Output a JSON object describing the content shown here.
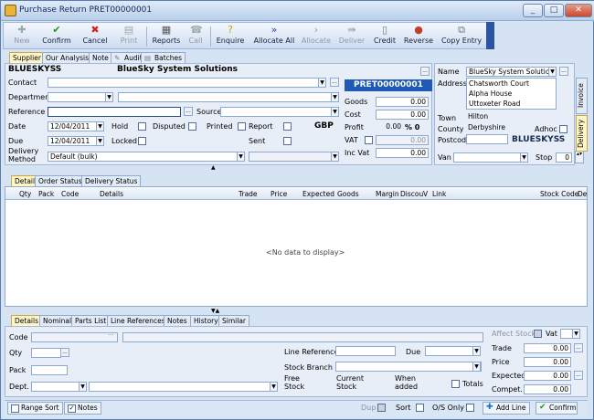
{
  "window": {
    "title": "Purchase Return PRET00000001",
    "min": "_",
    "max": "□",
    "close": "✕"
  },
  "toolbar": {
    "new": "New",
    "confirm": "Confirm",
    "cancel": "Cancel",
    "print": "Print",
    "reports": "Reports",
    "call": "Call",
    "enquire": "Enquire",
    "allocate_all": "Allocate All",
    "allocate": "Allocate",
    "deliver": "Deliver",
    "credit": "Credit",
    "reverse": "Reverse",
    "copy_entry": "Copy Entry"
  },
  "top_tabs": [
    "Supplier",
    "Our Analysis",
    "Note",
    "Audit",
    "Batches"
  ],
  "supplier": {
    "code": "BLUESKYSS",
    "name": "BlueSky System Solutions",
    "contact_label": "Contact",
    "department_label": "Department",
    "reference_label": "Reference",
    "source_label": "Source",
    "date_label": "Date",
    "date_value": "12/04/2011",
    "due_label": "Due",
    "due_value": "12/04/2011",
    "hold_label": "Hold",
    "disputed_label": "Disputed",
    "printed_label": "Printed",
    "report_label": "Report",
    "locked_label": "Locked",
    "sent_label": "Sent",
    "currency": "GBP",
    "delivery_method_label": "Delivery Method",
    "delivery_method_value": "Default (bulk)"
  },
  "totals": {
    "doc_number": "PRET00000001",
    "goods_label": "Goods",
    "goods": "0.00",
    "cost_label": "Cost",
    "cost": "0.00",
    "profit_label": "Profit",
    "profit": "0.00",
    "profit_pct": "% 0",
    "vat_label": "VAT",
    "vat": "0.00",
    "incvat_label": "Inc Vat",
    "incvat": "0.00"
  },
  "address": {
    "name_label": "Name",
    "name_value": "BlueSky System Solution",
    "address_label": "Address",
    "lines": [
      "Chatsworth Court",
      "Alpha House",
      "Uttoxeter Road"
    ],
    "town_label": "Town",
    "town": "Hilton",
    "county_label": "County",
    "county": "Derbyshire",
    "postcode_label": "Postcode",
    "adhoc_label": "Adhoc",
    "code_badge": "BLUESKYSS",
    "van_label": "Van",
    "stop_label": "Stop",
    "stop_value": "0"
  },
  "side_tabs": [
    "Invoice",
    "Delivery"
  ],
  "grid_tabs": [
    "Detail",
    "Order Status",
    "Delivery Status"
  ],
  "grid_columns": [
    "Qty",
    "Pack",
    "Code",
    "Details",
    "Trade",
    "Price",
    "Expected",
    "Goods",
    "Margin",
    "Discou",
    "V",
    "Link",
    "Stock Code",
    "De"
  ],
  "grid_empty": "<No data to display>",
  "bottom_tabs": [
    "Details",
    "Nominal",
    "Parts List",
    "Line References",
    "Notes",
    "History",
    "Similar"
  ],
  "bottom": {
    "code_label": "Code",
    "qty_label": "Qty",
    "pack_label": "Pack",
    "dept_label": "Dept.",
    "line_ref_label": "Line Reference",
    "due_label": "Due",
    "stock_branch_label": "Stock Branch",
    "free_stock_label": "Free Stock",
    "current_stock_label": "Current Stock",
    "when_added_label": "When added",
    "totals_label": "Totals",
    "affect_stock_label": "Affect Stock",
    "vat_label": "Vat",
    "trade_label": "Trade",
    "price_label": "Price",
    "expected_label": "Expected",
    "compet_label": "Compet.",
    "trade_value": "0.00",
    "price_value": "0.00",
    "expected_value": "0.00",
    "compet_value": "0.00"
  },
  "status": {
    "range_sort": "Range Sort",
    "notes": "Notes",
    "dup": "Dup",
    "sort": "Sort",
    "os_only": "O/S Only",
    "add_line": "Add Line",
    "confirm": "Confirm"
  }
}
